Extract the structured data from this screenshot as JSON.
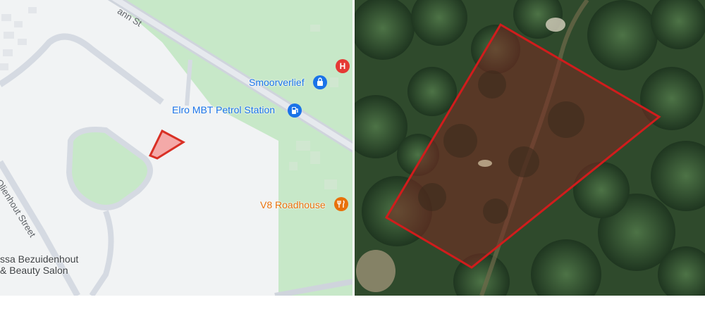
{
  "map": {
    "street_top": "ann St",
    "street_left": "Olienhout Street",
    "poi_smoorverlief": "Smoorverlief",
    "poi_petrol": "Elro MBT Petrol Station",
    "poi_roadhouse": "V8 Roadhouse",
    "poi_salon_line1": "ssa Bezuidenhout",
    "poi_salon_line2": "& Beauty Salon",
    "hospital_glyph": "H",
    "icons": {
      "hospital": "hospital-pin-icon",
      "shop": "shopping-bag-pin-icon",
      "fuel": "fuel-pump-pin-icon",
      "food": "restaurant-pin-icon"
    }
  },
  "colors": {
    "map_background": "#f1f3f4",
    "park_green": "#c7e8c8",
    "parcel_fill": "#f4a9a8",
    "parcel_stroke": "#d93025",
    "road": "#cfd4dc",
    "hospital_red": "#e53935",
    "poi_blue": "#1a73e8",
    "poi_orange": "#e8710a",
    "satellite_canopy": "#2f4a2c"
  }
}
